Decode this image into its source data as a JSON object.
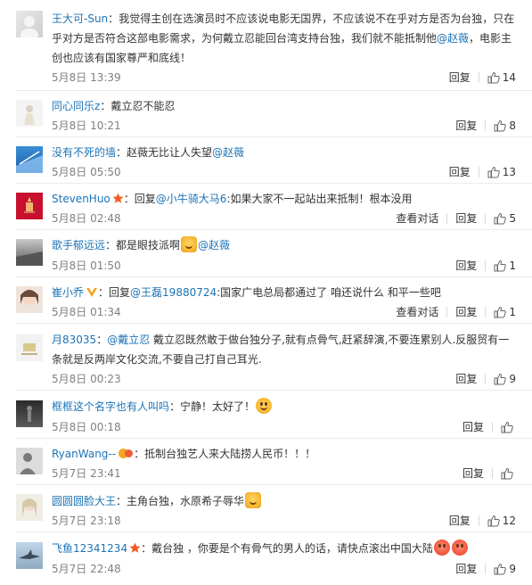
{
  "labels": {
    "reply": "回复",
    "view_dialog": "查看对话"
  },
  "comments": [
    {
      "user": "王大可-Sun",
      "sep": "：",
      "text_1": "我觉得主创在选演员时不应该说电影无国界，不应该说不在乎对方是否为台独，只在乎对方是否符合这部电影需求，为何戴立忍能回台湾支持台独，我们就不能抵制他",
      "mention": "@赵薇",
      "text_2": "，电影主创也应该有国家尊严和底线！",
      "time": "5月8日 13:39",
      "likes": "14"
    },
    {
      "user": "同心同乐z",
      "sep": "：",
      "text_1": "戴立忍不能忍",
      "time": "5月8日 10:21",
      "likes": "8"
    },
    {
      "user": "没有不死的墙",
      "sep": "：",
      "text_1": "赵薇无比让人失望",
      "mention": "@赵薇",
      "time": "5月8日 05:50",
      "likes": "13"
    },
    {
      "user": "StevenHuo",
      "sep": "：",
      "reply_word": "回复",
      "reply_to": "@小牛骑大马6",
      "text_1": ":如果大家不一起站出来抵制！根本没用",
      "time": "5月8日 02:48",
      "likes": "5",
      "view": true
    },
    {
      "user": "歌手郁远远",
      "sep": "：",
      "text_1": "都是眼技派啊",
      "mention": "@赵薇",
      "time": "5月8日 01:50",
      "likes": "1"
    },
    {
      "user": "崔小乔",
      "sep": "：",
      "reply_word": "回复",
      "reply_to": "@王磊19880724",
      "text_1": ":国家广电总局都通过了 咱还说什么 和平一些吧",
      "time": "5月8日 01:34",
      "likes": "1",
      "view": true
    },
    {
      "user": "月83035",
      "sep": "：",
      "mention": "@戴立忍",
      "text_1": " 戴立忍既然敢于做台独分子,就有点骨气,赶紧辞演,不要连累别人.反服贸有一条就是反两岸文化交流,不要自己打自己耳光.",
      "time": "5月8日 00:23",
      "likes": "9"
    },
    {
      "user": "框框这个名字也有人叫吗",
      "sep": "：",
      "text_1": "宁静！太好了！",
      "time": "5月8日 00:18",
      "likes": ""
    },
    {
      "user": "RyanWang--",
      "sep": "：",
      "text_1": "抵制台独艺人来大陆捞人民币！！！",
      "time": "5月7日 23:41",
      "likes": ""
    },
    {
      "user": "圆圆圆脸大王",
      "sep": "：",
      "text_1": "主角台独，水原希子辱华",
      "time": "5月7日 23:18",
      "likes": "12"
    },
    {
      "user": "飞鱼12341234",
      "sep": "：",
      "text_1": "戴台独 ，你要是个有骨气的男人的话，请快点滚出中国大陆",
      "time": "5月7日 22:48",
      "likes": "9"
    }
  ]
}
